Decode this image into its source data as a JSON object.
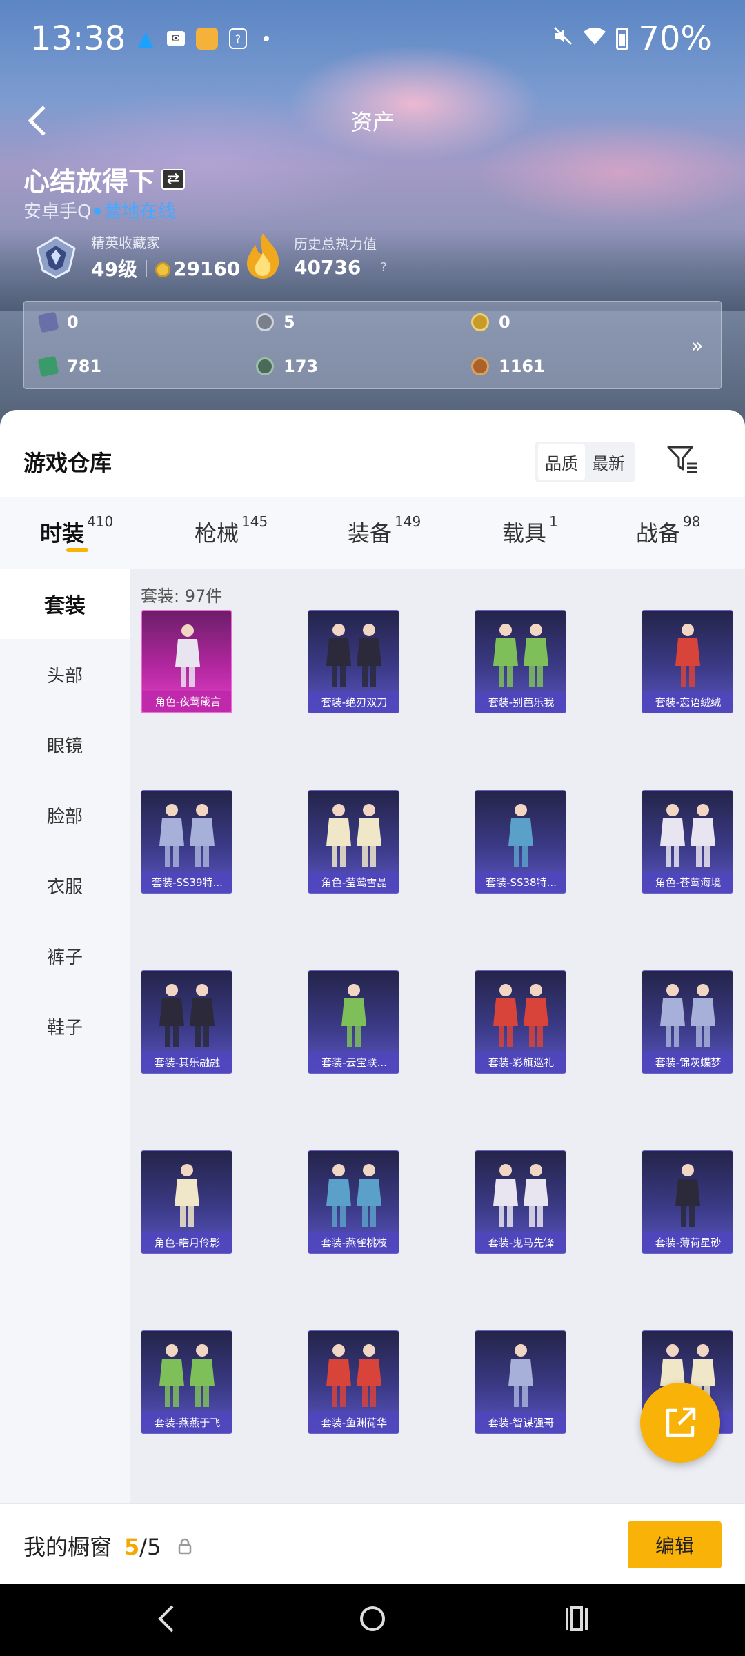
{
  "status_bar": {
    "time": "13:38",
    "battery_percent": "70%",
    "notification_icons": [
      "qq-icon",
      "mail-icon",
      "game-app-icon",
      "help-app-icon",
      "dot-icon"
    ],
    "right_icons": [
      "mute-icon",
      "wifi-icon",
      "battery-icon"
    ]
  },
  "header": {
    "title": "资产",
    "player_name": "心结放得下",
    "platform": "安卓手Q",
    "online_status": "营地在线",
    "rank": {
      "title": "精英收藏家",
      "level": "49级",
      "points": "29160"
    },
    "heat": {
      "title": "历史总热力值",
      "value": "40736",
      "help": "?"
    },
    "currencies": [
      {
        "icon": "card-icon",
        "value": "0",
        "color": "#6b6fa8"
      },
      {
        "icon": "silver-coin-icon",
        "value": "5",
        "color": "#7a7f8c"
      },
      {
        "icon": "gold-coin-icon",
        "value": "0",
        "color": "#c79b2a"
      },
      {
        "icon": "ticket-icon",
        "value": "781",
        "color": "#3a9a6a"
      },
      {
        "icon": "orb-icon",
        "value": "173",
        "color": "#4a6a5a"
      },
      {
        "icon": "bronze-coin-icon",
        "value": "1161",
        "color": "#a8622a"
      }
    ]
  },
  "warehouse": {
    "title": "游戏仓库",
    "sort_options": [
      "品质",
      "最新"
    ],
    "sort_active": "品质",
    "tabs": [
      {
        "label": "时装",
        "count": "410"
      },
      {
        "label": "枪械",
        "count": "145"
      },
      {
        "label": "装备",
        "count": "149"
      },
      {
        "label": "载具",
        "count": "1"
      },
      {
        "label": "战备",
        "count": "98"
      }
    ],
    "categories": [
      "套装",
      "头部",
      "眼镜",
      "脸部",
      "衣服",
      "裤子",
      "鞋子"
    ],
    "count_label": "套装: 97件",
    "items": [
      {
        "label": "角色-夜莺箴言",
        "rarity": "pink"
      },
      {
        "label": "套装-绝刃双刀",
        "rarity": "purple"
      },
      {
        "label": "套装-别芭乐我",
        "rarity": "purple"
      },
      {
        "label": "套装-恋语绒绒",
        "rarity": "purple"
      },
      {
        "label": "套装-SS39特...",
        "rarity": "purple"
      },
      {
        "label": "角色-莹莺雪晶",
        "rarity": "purple"
      },
      {
        "label": "套装-SS38特...",
        "rarity": "purple"
      },
      {
        "label": "角色-苍莺海境",
        "rarity": "purple"
      },
      {
        "label": "套装-其乐融融",
        "rarity": "purple"
      },
      {
        "label": "套装-云宝联...",
        "rarity": "purple"
      },
      {
        "label": "套装-彩旗巡礼",
        "rarity": "purple"
      },
      {
        "label": "套装-锦灰蝶梦",
        "rarity": "purple"
      },
      {
        "label": "角色-皓月伶影",
        "rarity": "purple"
      },
      {
        "label": "套装-燕雀桃枝",
        "rarity": "purple"
      },
      {
        "label": "套装-鬼马先锋",
        "rarity": "purple"
      },
      {
        "label": "套装-薄荷星砂",
        "rarity": "purple"
      },
      {
        "label": "套装-燕燕于飞",
        "rarity": "purple"
      },
      {
        "label": "套装-鱼渊荷华",
        "rarity": "purple"
      },
      {
        "label": "套装-智谋强哥",
        "rarity": "purple"
      },
      {
        "label": "…",
        "rarity": "purple"
      }
    ]
  },
  "showcase": {
    "label": "我的橱窗",
    "current": "5",
    "separator": "/",
    "total": "5",
    "edit_label": "编辑"
  },
  "colors": {
    "accent": "#f9b208",
    "online": "#48a8ff",
    "card_purple": "#3b3a86",
    "card_pink": "#b2279f"
  }
}
